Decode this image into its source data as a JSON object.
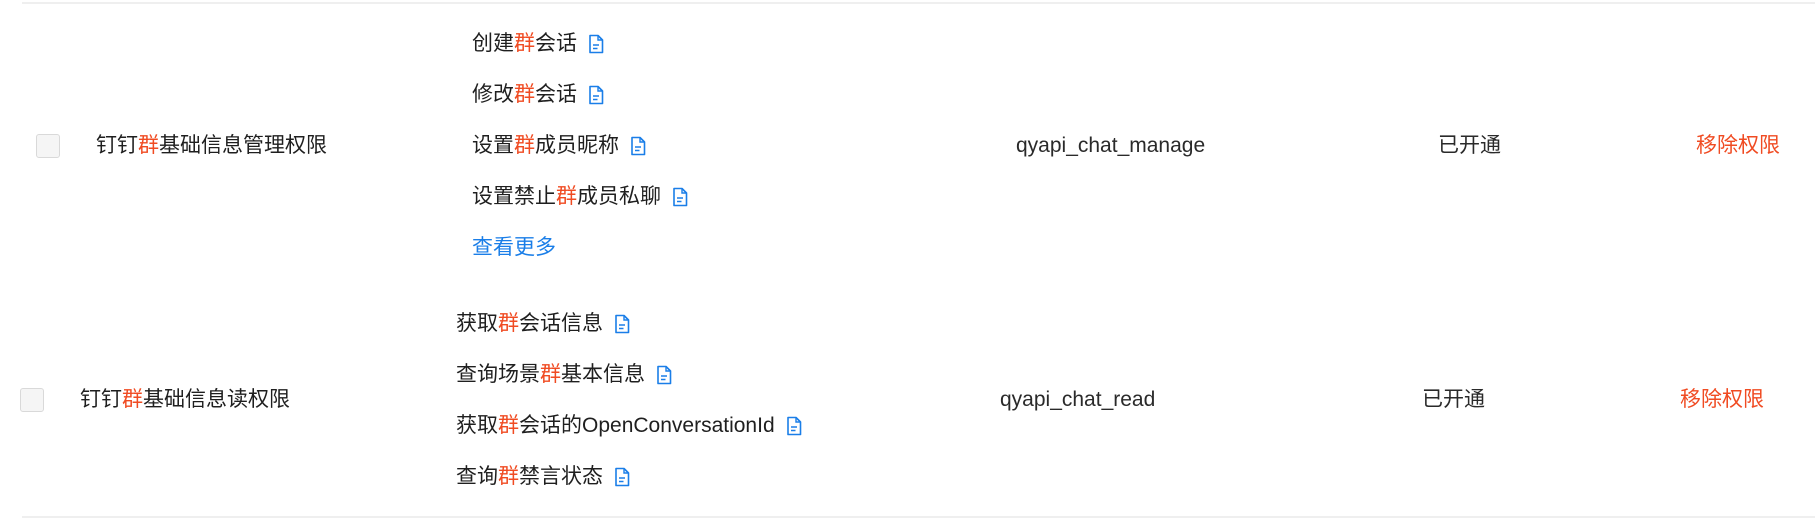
{
  "permissions": [
    {
      "name_prefix": "钉钉",
      "name_hl": "群",
      "name_suffix": "基础信息管理权限",
      "apis": [
        {
          "pre": "创建",
          "hl": "群",
          "post": "会话",
          "icon": "doc-icon"
        },
        {
          "pre": "修改",
          "hl": "群",
          "post": "会话",
          "icon": "doc-icon"
        },
        {
          "pre": "设置",
          "hl": "群",
          "post": "成员昵称",
          "icon": "doc-icon"
        },
        {
          "pre": "设置禁止",
          "hl": "群",
          "post": "成员私聊",
          "icon": "doc-icon"
        }
      ],
      "more_label": "查看更多",
      "scope": "qyapi_chat_manage",
      "status": "已开通",
      "action": "移除权限"
    },
    {
      "name_prefix": "钉钉",
      "name_hl": "群",
      "name_suffix": "基础信息读权限",
      "apis": [
        {
          "pre": "获取",
          "hl": "群",
          "post": "会话信息",
          "icon": "doc-icon"
        },
        {
          "pre": "查询场景",
          "hl": "群",
          "post": "基本信息",
          "icon": "doc-icon"
        },
        {
          "pre": "获取",
          "hl": "群",
          "post": "会话的OpenConversationId",
          "icon": "doc-icon"
        },
        {
          "pre": "查询",
          "hl": "群",
          "post": "禁言状态",
          "icon": "doc-icon"
        }
      ],
      "scope": "qyapi_chat_read",
      "status": "已开通",
      "action": "移除权限"
    }
  ],
  "colors": {
    "highlight": "#f04b22",
    "link": "#1a7ee8",
    "text": "#1f1f1f",
    "checkbox_bg": "#f5f5f5",
    "divider": "#efefef"
  }
}
